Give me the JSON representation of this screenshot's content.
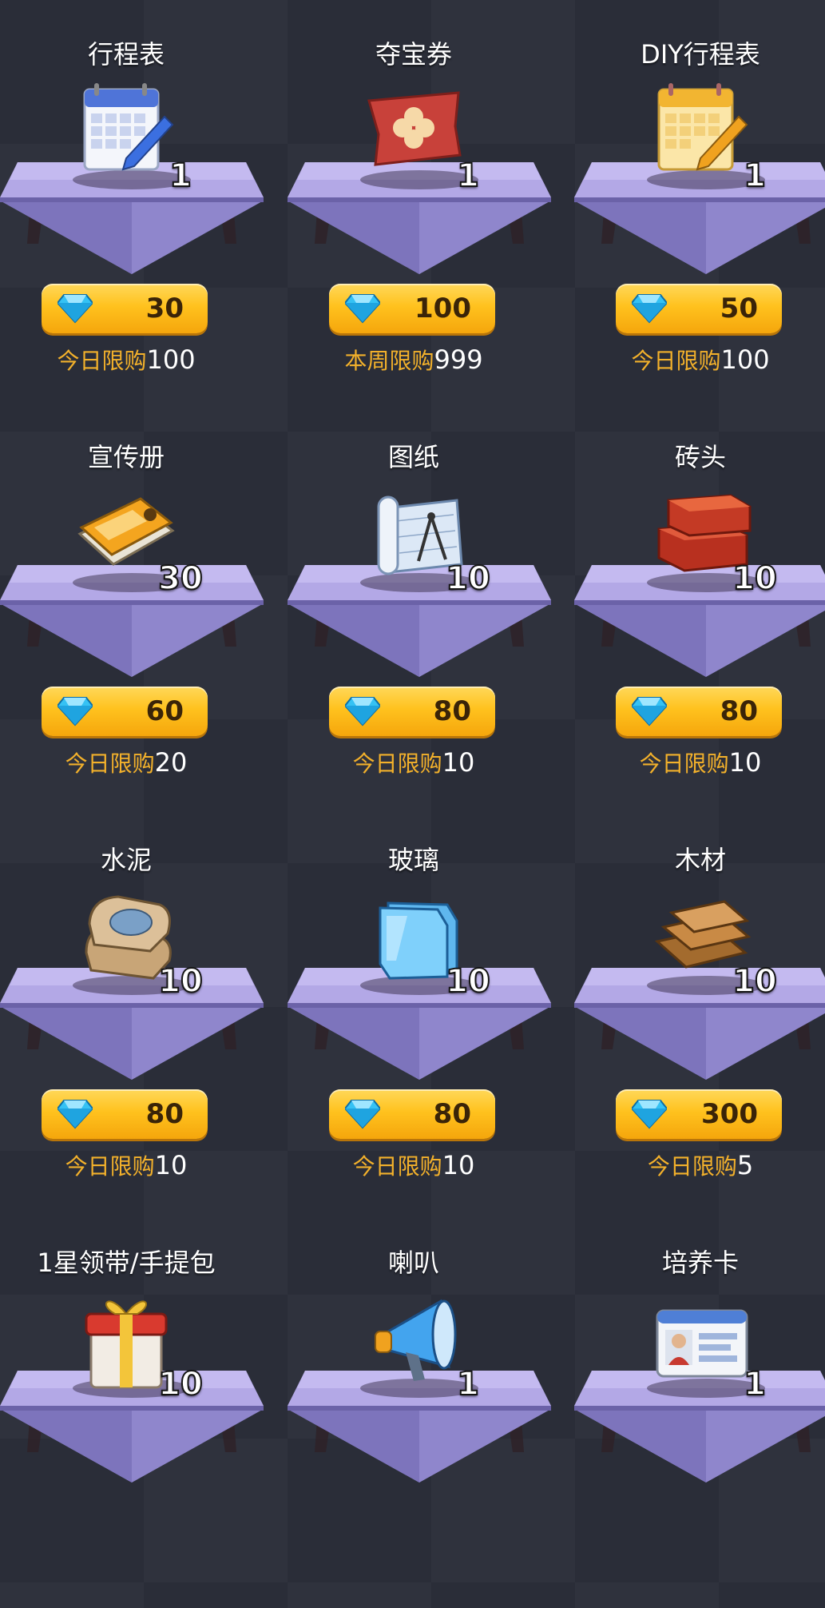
{
  "colors": {
    "background": "#2a2d38",
    "price_button": "#ffc21e",
    "limit_label": "#f3b12b",
    "pedestal": "#8c82c8",
    "gem": "#36c8f5"
  },
  "currency_icon": "diamond-gem-icon",
  "items": [
    {
      "id": "schedule",
      "name": "行程表",
      "icon": "calendar-icon",
      "count": "1",
      "price": "30",
      "limit_label": "今日限购",
      "limit_value": "100"
    },
    {
      "id": "treasure-coupon",
      "name": "夺宝券",
      "icon": "ticket-icon",
      "count": "1",
      "price": "100",
      "limit_label": "本周限购",
      "limit_value": "999"
    },
    {
      "id": "diy-schedule",
      "name": "DIY行程表",
      "icon": "diy-calendar-icon",
      "count": "1",
      "price": "50",
      "limit_label": "今日限购",
      "limit_value": "100"
    },
    {
      "id": "brochure",
      "name": "宣传册",
      "icon": "brochure-icon",
      "count": "30",
      "price": "60",
      "limit_label": "今日限购",
      "limit_value": "20"
    },
    {
      "id": "blueprint",
      "name": "图纸",
      "icon": "blueprint-icon",
      "count": "10",
      "price": "80",
      "limit_label": "今日限购",
      "limit_value": "10"
    },
    {
      "id": "brick",
      "name": "砖头",
      "icon": "brick-icon",
      "count": "10",
      "price": "80",
      "limit_label": "今日限购",
      "limit_value": "10"
    },
    {
      "id": "cement",
      "name": "水泥",
      "icon": "cement-bag-icon",
      "count": "10",
      "price": "80",
      "limit_label": "今日限购",
      "limit_value": "10"
    },
    {
      "id": "glass",
      "name": "玻璃",
      "icon": "glass-icon",
      "count": "10",
      "price": "80",
      "limit_label": "今日限购",
      "limit_value": "10"
    },
    {
      "id": "wood",
      "name": "木材",
      "icon": "wood-planks-icon",
      "count": "10",
      "price": "300",
      "limit_label": "今日限购",
      "limit_value": "5"
    },
    {
      "id": "gift-pack",
      "name": "1星领带/手提包",
      "icon": "gift-box-icon",
      "count": "10",
      "price": "",
      "limit_label": "",
      "limit_value": ""
    },
    {
      "id": "horn",
      "name": "喇叭",
      "icon": "megaphone-icon",
      "count": "1",
      "price": "",
      "limit_label": "",
      "limit_value": ""
    },
    {
      "id": "training-card",
      "name": "培养卡",
      "icon": "id-card-icon",
      "count": "1",
      "price": "",
      "limit_label": "",
      "limit_value": ""
    }
  ]
}
